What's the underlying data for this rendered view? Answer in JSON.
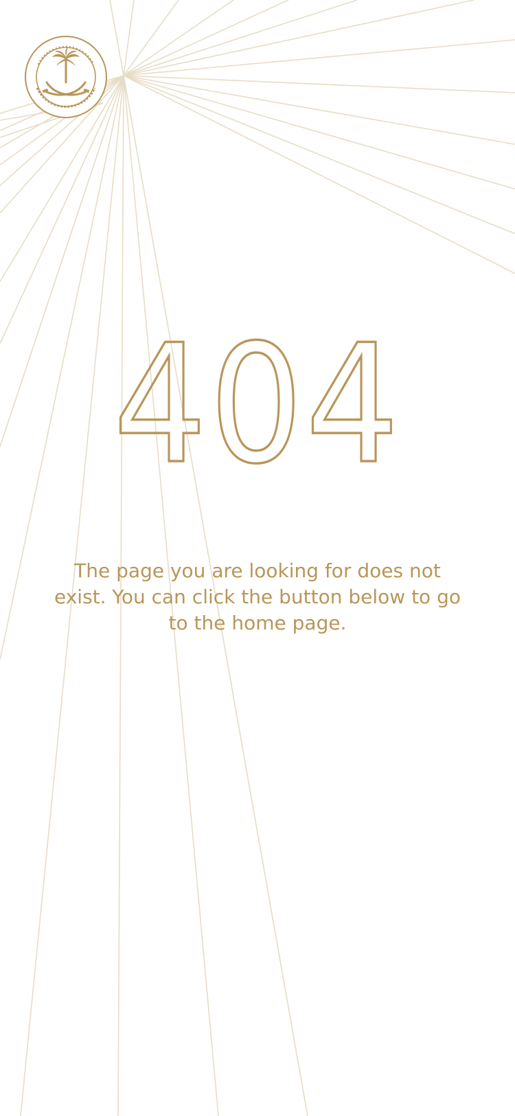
{
  "logo": {
    "icon": "pif-emblem-icon",
    "ring_text": "Public Investment Fund 1971 · صندوق الاستثمارات العامة ١٣٩١"
  },
  "error": {
    "code": "404",
    "message": "The page you are looking for does not exist. You can click the button below to go to the home page."
  },
  "colors": {
    "accent": "#b8965a",
    "rays": "#e7dcc6",
    "background": "#ffffff"
  }
}
